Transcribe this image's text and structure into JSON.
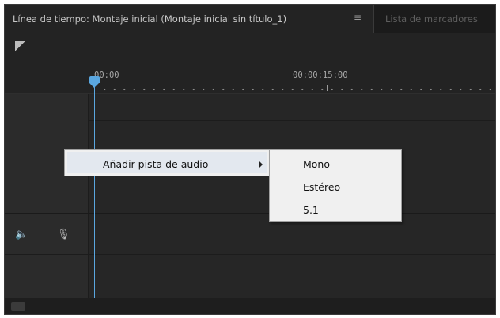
{
  "tabs": {
    "active_title": "Línea de tiempo: Montaje inicial (Montaje inicial sin título_1)",
    "menu_glyph": "≡",
    "inactive_title": "Lista de marcadores"
  },
  "ruler": {
    "timecode_start": "00:00",
    "timecode_mid": "00:00:15:00"
  },
  "track_header": {
    "speaker_icon": "speaker-icon",
    "mic_icon": "microphone-icon"
  },
  "context_menu": {
    "item_label": "Añadir pista de audio",
    "submenu": [
      "Mono",
      "Estéreo",
      "5.1"
    ]
  },
  "colors": {
    "panel_bg": "#232323",
    "playhead": "#5aa7e0",
    "menu_bg": "#f0f0f0"
  }
}
